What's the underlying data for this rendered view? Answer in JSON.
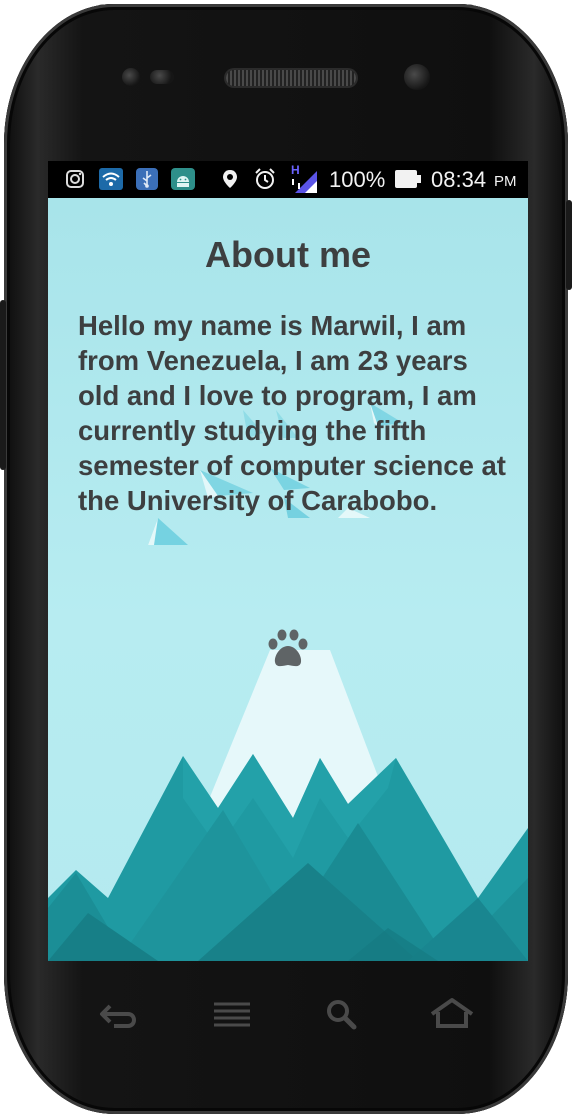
{
  "status_bar": {
    "icons": [
      "instagram-icon",
      "wifi-app-icon",
      "usb-debug-icon",
      "android-icon",
      "location-icon",
      "alarm-icon",
      "hspa-signal-icon",
      "battery-icon"
    ],
    "signal_type": "H",
    "battery_percent": "100%",
    "time": "08:34",
    "ampm": "PM"
  },
  "app": {
    "title": "About me",
    "bio": "Hello my name is Marwil, I am from Venezuela, I am 23 years old and I love to program, I am currently studying the fifth semester of computer science at the University of Carabobo."
  },
  "nav_bar": {
    "keys": [
      "back-icon",
      "menu-icon",
      "search-icon",
      "home-icon"
    ]
  },
  "colors": {
    "background_top": "#a8e4ea",
    "background_bottom": "#b4eaef",
    "text": "#3d3f40",
    "mountain_dark": "#1f8b93",
    "mountain_mid": "#2ea3ab",
    "snow": "#eafafb"
  }
}
